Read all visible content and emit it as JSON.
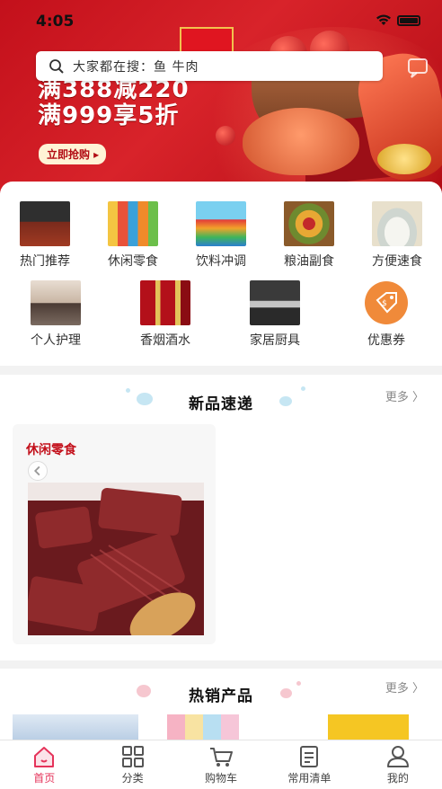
{
  "status": {
    "time": "4:05"
  },
  "search": {
    "placeholder": "大家都在搜：鱼 牛肉"
  },
  "banner": {
    "line1": "满388减220",
    "line2": "满999享5折",
    "button": "立即抢购 ▸"
  },
  "categories": [
    {
      "label": "热门推荐",
      "icon": "hot-recommend-icon"
    },
    {
      "label": "休闲零食",
      "icon": "snacks-icon"
    },
    {
      "label": "饮料冲调",
      "icon": "drinks-icon"
    },
    {
      "label": "粮油副食",
      "icon": "grain-oil-icon"
    },
    {
      "label": "方便速食",
      "icon": "instant-food-icon"
    },
    {
      "label": "个人护理",
      "icon": "personal-care-icon"
    },
    {
      "label": "香烟酒水",
      "icon": "tobacco-liquor-icon"
    },
    {
      "label": "家居厨具",
      "icon": "home-kitchen-icon"
    },
    {
      "label": "优惠券",
      "icon": "coupon-icon"
    }
  ],
  "new_arrivals": {
    "title": "新品速递",
    "more": "更多 〉",
    "card_title": "休闲零食"
  },
  "hot_products": {
    "title": "热销产品",
    "more": "更多 〉"
  },
  "tabs": [
    {
      "label": "首页",
      "icon": "home-icon",
      "active": true
    },
    {
      "label": "分类",
      "icon": "category-icon",
      "active": false
    },
    {
      "label": "购物车",
      "icon": "cart-icon",
      "active": false
    },
    {
      "label": "常用清单",
      "icon": "list-icon",
      "active": false
    },
    {
      "label": "我的",
      "icon": "profile-icon",
      "active": false
    }
  ],
  "colors": {
    "accent": "#e5335a",
    "banner_red": "#c3101b"
  }
}
